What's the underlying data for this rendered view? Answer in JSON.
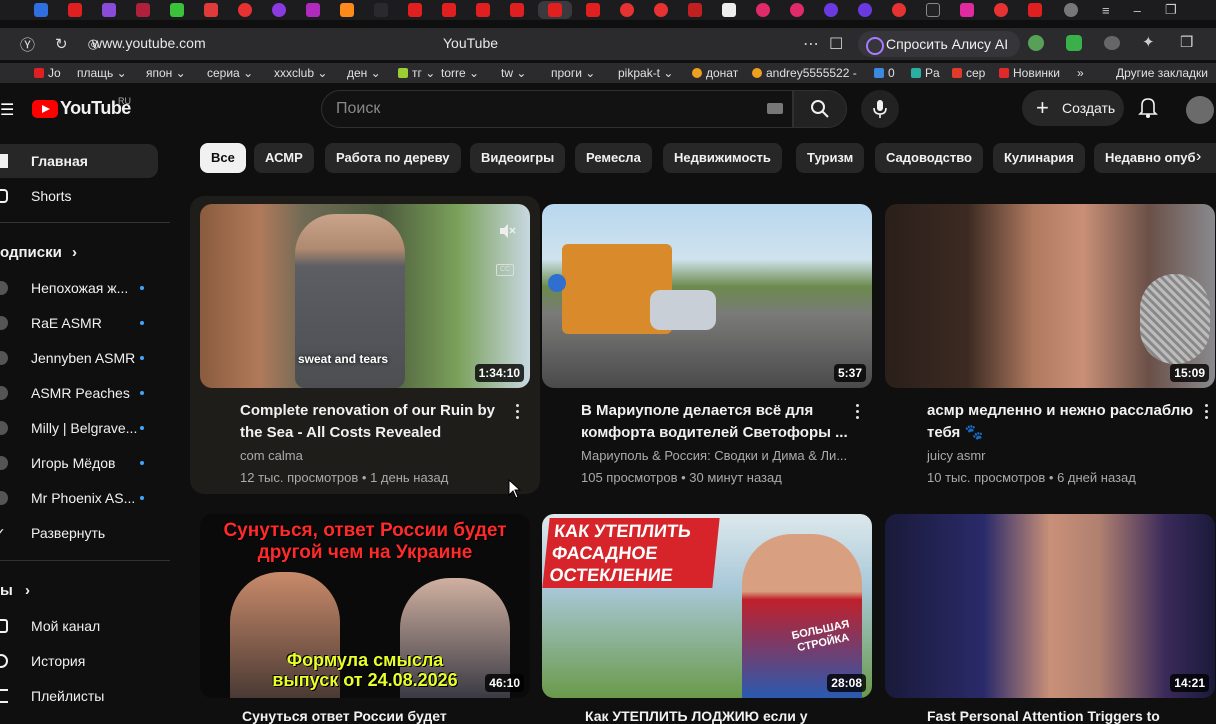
{
  "browser": {
    "url": "www.youtube.com",
    "page_title": "YouTube",
    "alice_button": "Спросить Алису AI",
    "bookmarks": [
      "Jo",
      "плащь",
      "япон",
      "сериа",
      "xxxclub",
      "ден",
      "тг",
      "torre",
      "tw",
      "проги",
      "pikpak-t",
      "донат",
      "andrey5555522 -",
      "0",
      "Pa",
      "сер",
      "Новинки",
      "Другие закладки"
    ],
    "bookmark_more": "»"
  },
  "header": {
    "logo_text": "YouTube",
    "logo_region": "RU",
    "search_placeholder": "Поиск",
    "create_label": "Создать"
  },
  "sidebar": {
    "main": [
      {
        "label": "Главная"
      },
      {
        "label": "Shorts"
      }
    ],
    "subs_heading": "одписки",
    "subs_chevron": "›",
    "subscriptions": [
      {
        "label": "Непохожая ж..."
      },
      {
        "label": "RaE ASMR"
      },
      {
        "label": "Jennyben ASMR"
      },
      {
        "label": "ASMR Peaches"
      },
      {
        "label": "Milly | Belgrave..."
      },
      {
        "label": "Игорь Мёдов"
      },
      {
        "label": "Mr Phoenix AS..."
      }
    ],
    "expand_label": "Развернуть",
    "you_heading": "ы",
    "you_chevron": "›",
    "you_items": [
      {
        "label": "Мой канал"
      },
      {
        "label": "История"
      },
      {
        "label": "Плейлисты"
      }
    ]
  },
  "chips": [
    "Все",
    "АСМР",
    "Работа по дереву",
    "Видеоигры",
    "Ремесла",
    "Недвижимость",
    "Туризм",
    "Садоводство",
    "Кулинария",
    "Недавно опуб"
  ],
  "videos": [
    {
      "title": "Complete renovation of our Ruin by the Sea - All Costs Revealed",
      "channel": "com calma",
      "meta": "12 тыс. просмотров • 1 день назад",
      "duration": "1:34:10",
      "overlay": "sweat and tears",
      "cc": "CC"
    },
    {
      "title": "В Мариуполе делается всё для комфорта водителей Светофоры ...",
      "channel": "Мариуполь & Россия: Сводки и Дима & Ли...",
      "meta": "105 просмотров • 30 минут назад",
      "duration": "5:37"
    },
    {
      "title": "асмр медленно и нежно расслаблю тебя 🐾",
      "channel": "juicy asmr",
      "meta": "10 тыс. просмотров • 6 дней назад",
      "duration": "15:09"
    },
    {
      "thumb_title": "Сунуться, ответ России будет другой чем на Украине",
      "thumb_sub": "Формула смысла выпуск от 24.08.2026",
      "duration": "46:10",
      "title_cut": "Сунуться ответ России будет"
    },
    {
      "thumb_title": "КАК УТЕПЛИТЬ ФАСАДНОЕ ОСТЕКЛЕНИЕ",
      "thumb_badge": "БОЛЬШАЯ СТРОЙКА",
      "duration": "28:08",
      "title_cut": "Как УТЕПЛИТЬ ЛОДЖИЮ если у"
    },
    {
      "duration": "14:21",
      "title_cut": "Fast Personal Attention Triggers to"
    }
  ]
}
